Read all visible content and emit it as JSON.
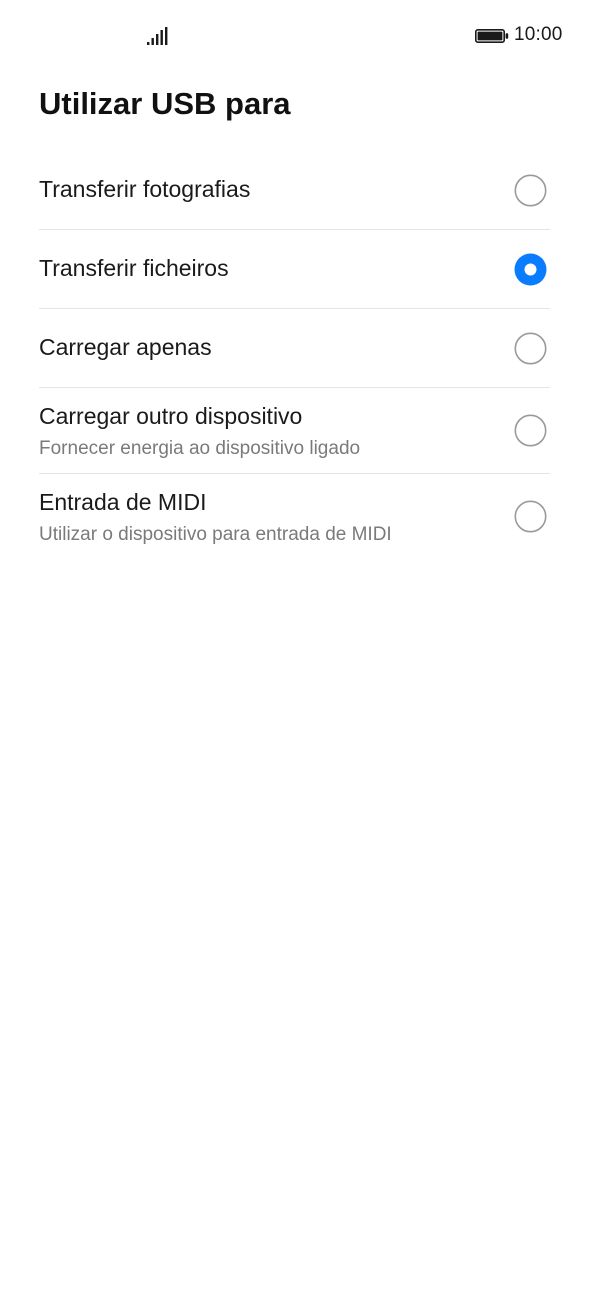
{
  "status_bar": {
    "time": "10:00",
    "signal_icon": "signal-bars-icon",
    "battery_icon": "battery-full-icon"
  },
  "page": {
    "title": "Utilizar USB para"
  },
  "options": [
    {
      "title": "Transferir fotografias",
      "subtitle": "",
      "selected": false
    },
    {
      "title": "Transferir ficheiros",
      "subtitle": "",
      "selected": true
    },
    {
      "title": "Carregar apenas",
      "subtitle": "",
      "selected": false
    },
    {
      "title": "Carregar outro dispositivo",
      "subtitle": "Fornecer energia ao dispositivo ligado",
      "selected": false
    },
    {
      "title": "Entrada de MIDI",
      "subtitle": "Utilizar o dispositivo para entrada de MIDI",
      "selected": false
    }
  ],
  "colors": {
    "accent": "#0a7cff",
    "radio_off": "#9a9a9a",
    "divider": "#e5e5e5",
    "subtitle": "#7a7a7a"
  }
}
